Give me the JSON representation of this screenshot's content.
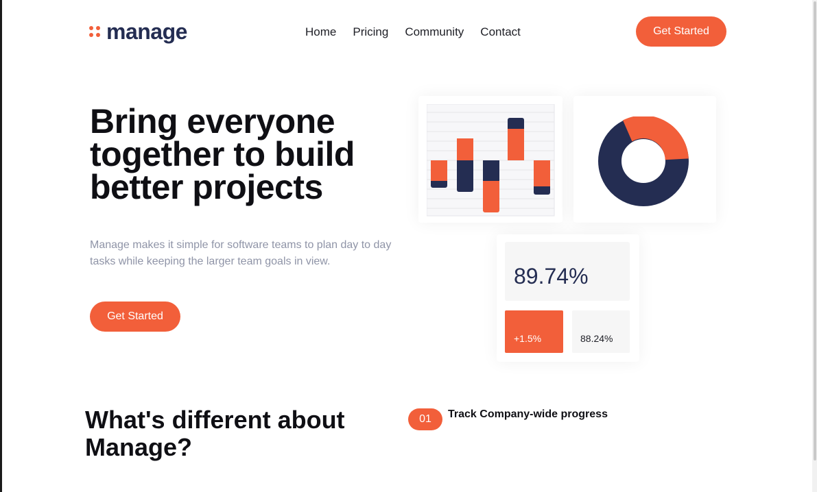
{
  "header": {
    "brand": "manage",
    "nav": [
      "Home",
      "Pricing",
      "Community",
      "Contact"
    ],
    "cta_label": "Get Started"
  },
  "hero": {
    "title": "Bring everyone together to build better projects",
    "subtitle": "Manage makes it simple for software teams to plan day to day tasks while keeping the larger team goals in view.",
    "cta_label": "Get Started"
  },
  "stats": {
    "main_value": "89.74%",
    "change_value": "+1.5%",
    "secondary_value": "88.24%"
  },
  "features": {
    "title": "What's different about Manage?",
    "items": [
      {
        "number": "01",
        "title": "Track Company-wide progress"
      }
    ]
  },
  "colors": {
    "accent": "#f25f3a",
    "navy": "#242d52",
    "muted_text": "#8f94a7"
  },
  "icons": {
    "logo": "logo-dots-icon"
  }
}
